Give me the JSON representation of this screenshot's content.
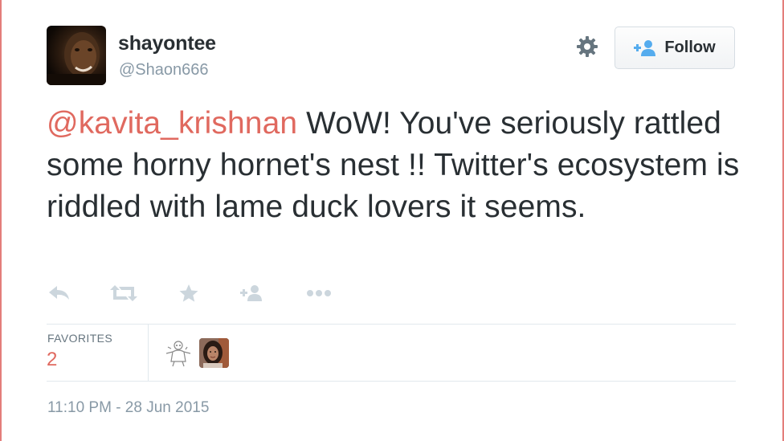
{
  "user": {
    "display_name": "shayontee",
    "screen_name": "@Shaon666",
    "avatar_icon": "user-photo-avatar"
  },
  "header": {
    "settings_icon": "gear-icon",
    "follow_label": "Follow",
    "follow_icon": "add-user-icon"
  },
  "tweet": {
    "mention": "@kavita_krishnan",
    "body": " WoW! You've seriously rattled some horny hornet's nest !! Twitter's ecosystem is riddled with lame duck lovers it seems."
  },
  "actions": [
    {
      "name": "reply",
      "icon": "reply-icon"
    },
    {
      "name": "retweet",
      "icon": "retweet-icon"
    },
    {
      "name": "favorite",
      "icon": "star-icon"
    },
    {
      "name": "follow",
      "icon": "add-user-icon"
    },
    {
      "name": "more",
      "icon": "more-dots-icon"
    }
  ],
  "stats": {
    "favorites_label": "FAVORITES",
    "favorites_count": "2"
  },
  "timestamp": "11:10 PM - 28 Jun 2015",
  "colors": {
    "text": "#292f33",
    "muted": "#8899a6",
    "mention": "#e0695f",
    "action_icon": "#ccd6dd",
    "follow_icon": "#55acee",
    "divider": "#e1e8ed"
  }
}
